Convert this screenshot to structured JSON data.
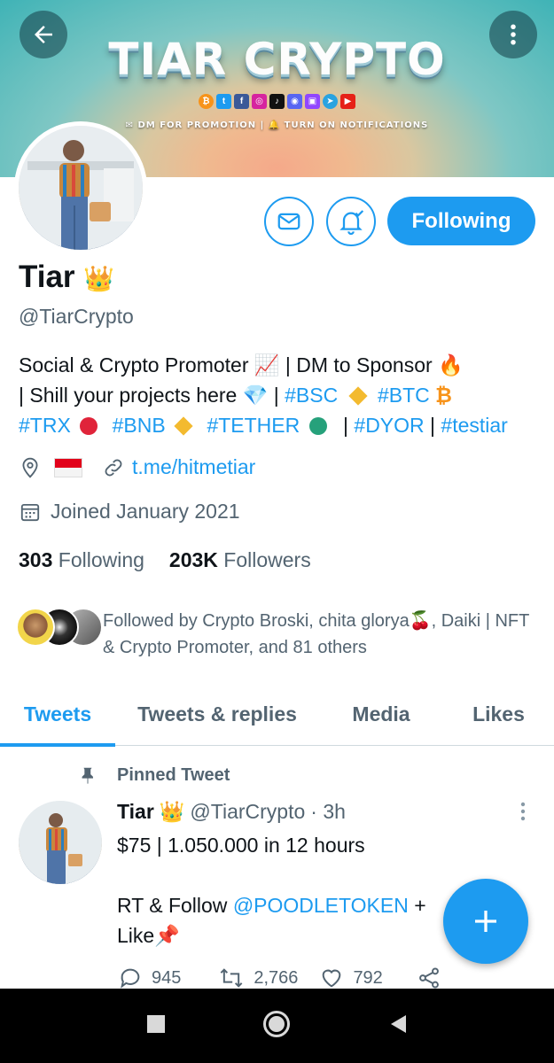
{
  "header": {
    "banner_title": "TIAR CRYPTO",
    "banner_subtitle": "✉ DM FOR PROMOTION | 🔔 TURN ON NOTIFICATIONS",
    "banner_icons": [
      "bitcoin-icon",
      "twitter-icon",
      "facebook-icon",
      "instagram-icon",
      "tiktok-icon",
      "discord-icon",
      "twitch-icon",
      "telegram-icon",
      "youtube-icon"
    ]
  },
  "profile": {
    "name": "Tiar",
    "name_badge": "👑",
    "handle": "@TiarCrypto",
    "follow_label": "Following",
    "bio_line1_a": "Social & Crypto Promoter 📈 | DM to Sponsor 🔥",
    "bio_line2_a": "| Shill your projects here 💎 | ",
    "bio_tag_bsc": "#BSC",
    "bio_tag_btc": "#BTC",
    "bio_tag_trx": "#TRX",
    "bio_tag_bnb": "#BNB",
    "bio_tag_tether": "#TETHER",
    "bio_tag_dyor": "#DYOR",
    "bio_tag_testiar": "#testiar",
    "location_flag": "🇮🇩",
    "website": "t.me/hitmetiar",
    "joined": "Joined January 2021",
    "following_count": "303",
    "following_label": "Following",
    "followers_count": "203K",
    "followers_label": "Followers",
    "followed_by": "Followed by Crypto Broski, chita glorya🍒, Daiki | NFT & Crypto Promoter, and 81 others"
  },
  "tabs": [
    {
      "label": "Tweets"
    },
    {
      "label": "Tweets & replies"
    },
    {
      "label": "Media"
    },
    {
      "label": "Likes"
    }
  ],
  "tweet": {
    "pinned_label": "Pinned Tweet",
    "name": "Tiar",
    "badge": "👑",
    "handle": "@TiarCrypto",
    "time": "· 3h",
    "line1": "$75 | 1.050.000 in 12 hours",
    "line2_a": "RT & Follow ",
    "line2_mention": "@POODLETOKEN",
    "line2_b": " +",
    "line3": "Like📌",
    "replies": "945",
    "retweets": "2,766",
    "likes": "792"
  },
  "colors": {
    "accent": "#1d9bf0",
    "text": "#0f1419",
    "muted": "#536471"
  }
}
